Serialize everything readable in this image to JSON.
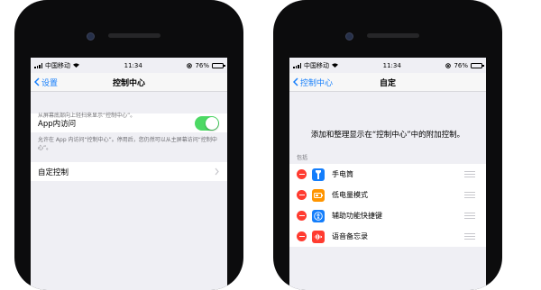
{
  "left": {
    "status": {
      "carrier": "中国移动",
      "time": "11:34",
      "battery_text": "76%",
      "battery_level": 0.76
    },
    "nav": {
      "back_label": "设置",
      "title": "控制中心"
    },
    "hint": "从屏幕底部向上轻扫来显示“控制中心”。",
    "app_access": {
      "label": "App内访问",
      "enabled": true,
      "description": "允许在 App 内访问“控制中心”。停用后，您仍然可以从主屏幕访问“控制中心”。"
    },
    "custom_controls_label": "自定控制"
  },
  "right": {
    "status": {
      "carrier": "中国移动",
      "time": "11:34",
      "battery_text": "76%",
      "battery_level": 0.76
    },
    "nav": {
      "back_label": "控制中心",
      "title": "自定"
    },
    "intro": "添加和整理显示在“控制中心”中的附加控制。",
    "section_header": "包括",
    "included": [
      {
        "label": "手电筒",
        "icon": "flashlight-icon",
        "color": "#147efb"
      },
      {
        "label": "低电量模式",
        "icon": "battery-icon",
        "color": "#ff9500"
      },
      {
        "label": "辅助功能快捷键",
        "icon": "accessibility-icon",
        "color": "#147efb"
      },
      {
        "label": "语音备忘录",
        "icon": "waveform-icon",
        "color": "#ff3b30"
      }
    ]
  },
  "colors": {
    "accent": "#147efb",
    "toggle_on": "#4cd964",
    "remove": "#ff3b30"
  }
}
